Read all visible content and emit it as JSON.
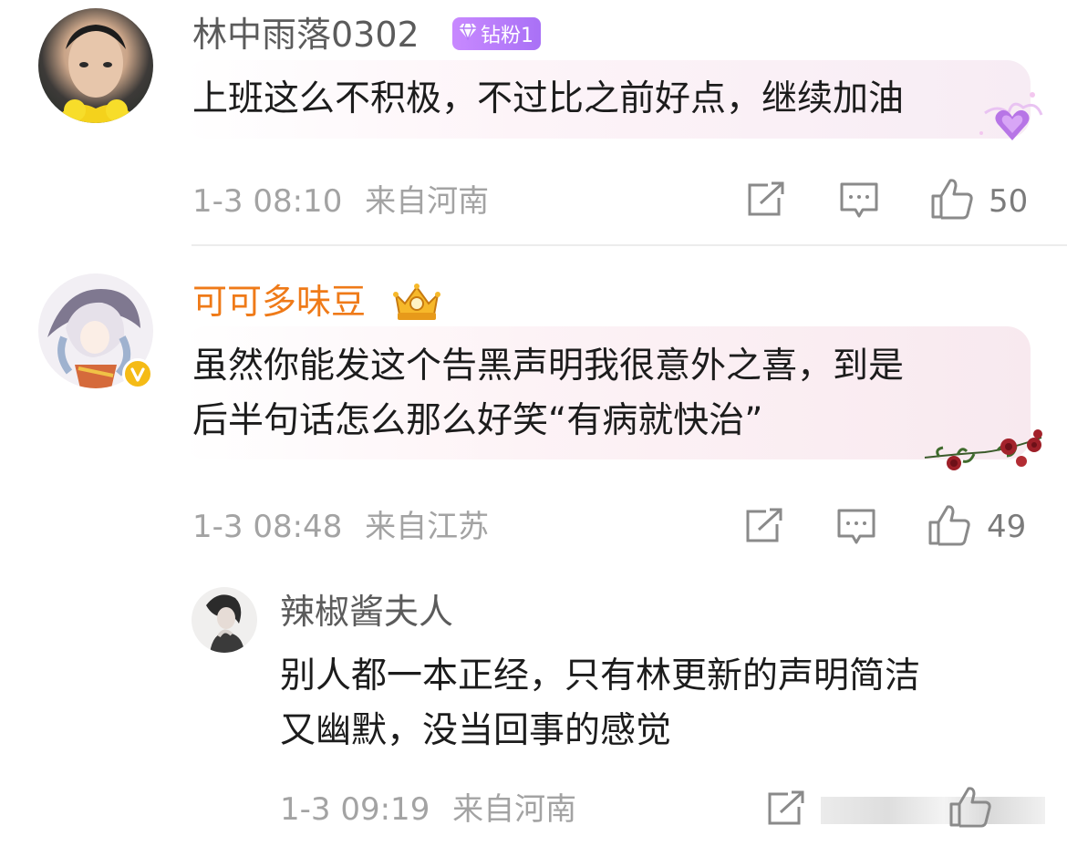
{
  "comments": [
    {
      "username": "林中雨落0302",
      "badge_label": "钻粉1",
      "text": "上班这么不积极，不过比之前好点，继续加油",
      "time": "1-3 08:10",
      "location": "来自河南",
      "likes": "50"
    },
    {
      "username": "可可多味豆",
      "text_line1": "虽然你能发这个告黑声明我很意外之喜，到是",
      "text_line2": "后半句话怎么那么好笑“有病就快治”",
      "time": "1-3 08:48",
      "location": "来自江苏",
      "likes": "49"
    }
  ],
  "reply": {
    "username": "辣椒酱夫人",
    "text_line1": "别人都一本正经，只有林更新的声明简洁",
    "text_line2": "又幽默，没当回事的感觉",
    "time": "1-3 09:19",
    "location": "来自河南"
  },
  "icons": [
    "repost-icon",
    "comment-icon",
    "like-icon",
    "crown-badge-icon",
    "verified-icon",
    "diamond-icon"
  ],
  "colors": {
    "username_highlight": "#ef7a18",
    "badge": "#b47bf8",
    "bubble_pink": "#fbeef3"
  }
}
